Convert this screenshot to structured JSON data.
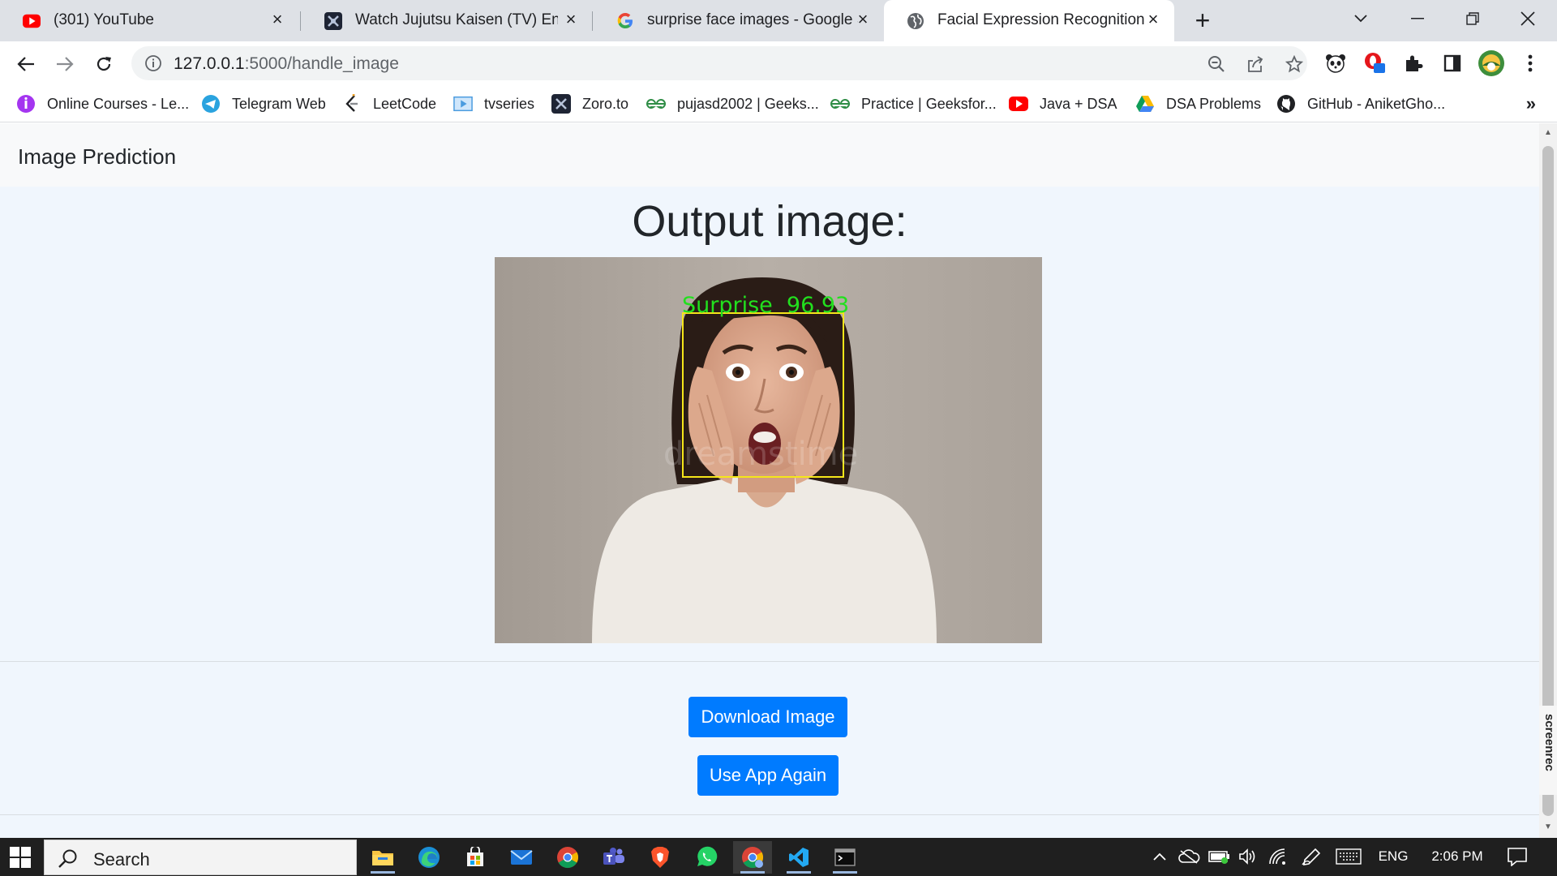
{
  "browser": {
    "tabs": [
      {
        "title": "(301) YouTube",
        "icon": "youtube-icon",
        "active": false
      },
      {
        "title": "Watch Jujutsu Kaisen (TV) English",
        "icon": "zoro-icon",
        "active": false
      },
      {
        "title": "surprise face images - Google Se",
        "icon": "google-icon",
        "active": false
      },
      {
        "title": "Facial Expression Recognition Ap",
        "icon": "globe-icon",
        "active": true
      }
    ],
    "url_host": "127.0.0.1",
    "url_path": ":5000/handle_image",
    "bookmarks": [
      "Online Courses - Le...",
      "Telegram Web",
      "LeetCode",
      "tvseries",
      "Zoro.to",
      "pujasd2002 | Geeks...",
      "Practice | Geeksfor...",
      "Java + DSA",
      "DSA Problems",
      "GitHub - AniketGho..."
    ],
    "bookmarks_more": "»"
  },
  "page": {
    "brand": "Image Prediction",
    "heading": "Output image:",
    "prediction_label": "Surprise  96.93",
    "watermark": "dreamstime",
    "download_button": "Download Image",
    "again_button": "Use App Again"
  },
  "screenrec_label": "screenrec",
  "taskbar": {
    "search_placeholder": "Search",
    "language": "ENG",
    "time": "2:06 PM"
  },
  "colors": {
    "primary": "#007bff",
    "page_bg": "#f0f6fd",
    "navbar_bg": "#f8f9fa",
    "detection_box": "#f5e61a",
    "detection_text": "#22e01e"
  }
}
